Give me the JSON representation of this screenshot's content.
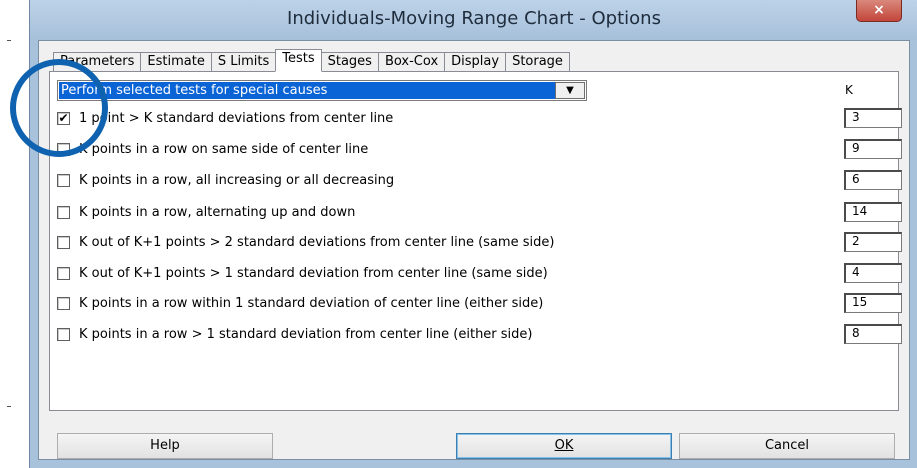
{
  "window": {
    "title": "Individuals-Moving Range Chart - Options",
    "close_glyph": "×"
  },
  "tabs": [
    {
      "label": "Parameters",
      "active": false
    },
    {
      "label": "Estimate",
      "active": false
    },
    {
      "label": "S Limits",
      "active": false
    },
    {
      "label": "Tests",
      "active": true
    },
    {
      "label": "Stages",
      "active": false
    },
    {
      "label": "Box-Cox",
      "active": false
    },
    {
      "label": "Display",
      "active": false
    },
    {
      "label": "Storage",
      "active": false
    }
  ],
  "tests_selector": {
    "selected": "Perform selected tests for special causes",
    "arrow_glyph": "▼"
  },
  "k_header": "K",
  "tests": [
    {
      "label": "1 point > K standard deviations from center line",
      "checked": true,
      "k": "3"
    },
    {
      "label": "K points in a row on same side of center line",
      "checked": false,
      "k": "9"
    },
    {
      "label": "K points in a row, all increasing or all decreasing",
      "checked": false,
      "k": "6"
    },
    {
      "label": "K points in a row, alternating up and down",
      "checked": false,
      "k": "14"
    },
    {
      "label": "K out of K+1 points > 2 standard deviations from center line (same side)",
      "checked": false,
      "k": "2"
    },
    {
      "label": "K out of K+1 points > 1 standard deviation from center line (same side)",
      "checked": false,
      "k": "4"
    },
    {
      "label": "K points in a row within 1 standard deviation of center line (either side)",
      "checked": false,
      "k": "15"
    },
    {
      "label": "K points in a row > 1 standard deviation from center line (either side)",
      "checked": false,
      "k": "8"
    }
  ],
  "buttons": {
    "help": "Help",
    "ok": "OK",
    "cancel": "Cancel"
  },
  "colors": {
    "selection": "#0a64d6",
    "annotation_circle": "#0f62b0",
    "close_button": "#c4453a"
  }
}
